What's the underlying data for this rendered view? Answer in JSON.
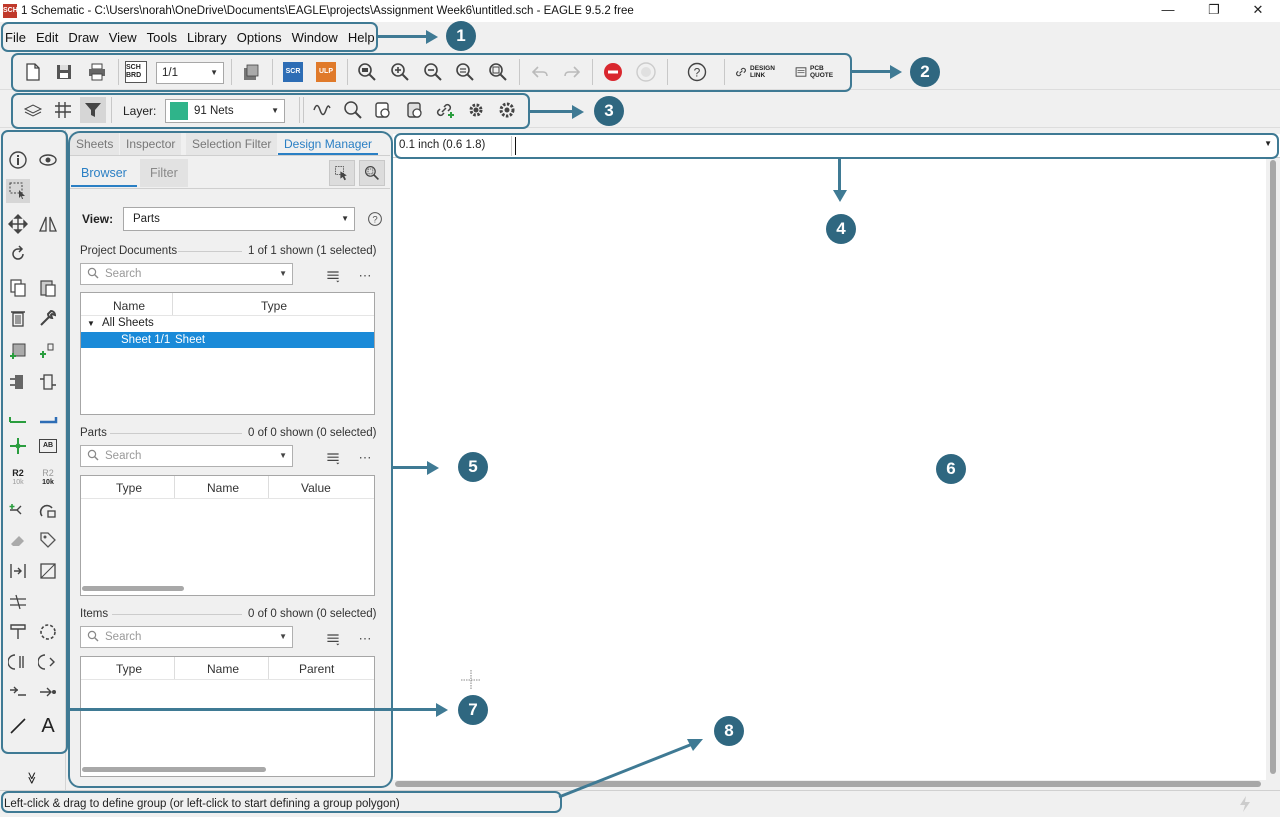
{
  "window": {
    "title": "1 Schematic - C:\\Users\\norah\\OneDrive\\Documents\\EAGLE\\projects\\Assignment Week6\\untitled.sch - EAGLE 9.5.2 free",
    "app_icon_text": "SCH",
    "minimize": "—",
    "restore": "❐",
    "close": "✕"
  },
  "menu": [
    "File",
    "Edit",
    "Draw",
    "View",
    "Tools",
    "Library",
    "Options",
    "Window",
    "Help"
  ],
  "toolbar1": {
    "sheet_select": "1/1",
    "sch_brd_label": "SCH BRD",
    "scr_label": "SCR",
    "ulp_label": "ULP",
    "design_link_label": "DESIGN LINK",
    "pcb_quote_label": "PCB QUOTE"
  },
  "toolbar2": {
    "layer_label": "Layer:",
    "layer_value": "91 Nets",
    "layer_color": "#2fb48a"
  },
  "panel": {
    "tabs": [
      "Sheets",
      "Inspector",
      "Selection Filter",
      "Design Manager"
    ],
    "subtabs": [
      "Browser",
      "Filter"
    ],
    "view_label": "View:",
    "view_value": "Parts",
    "sections": {
      "project_documents": {
        "title": "Project Documents",
        "count": "1 of 1 shown (1 selected)",
        "search_placeholder": "Search",
        "columns": [
          "Name",
          "Type"
        ],
        "tree_root": "All Sheets",
        "rows": [
          {
            "name": "Sheet 1/1",
            "type": "Sheet"
          }
        ]
      },
      "parts": {
        "title": "Parts",
        "count": "0 of 0 shown (0 selected)",
        "search_placeholder": "Search",
        "columns": [
          "Type",
          "Name",
          "Value"
        ]
      },
      "items": {
        "title": "Items",
        "count": "0 of 0 shown (0 selected)",
        "search_placeholder": "Search",
        "columns": [
          "Type",
          "Name",
          "Parent"
        ]
      }
    }
  },
  "command_line": {
    "grid_readout": "0.1 inch (0.6 1.8)",
    "value": ""
  },
  "left_tools": {
    "r2_label": "R2",
    "r2_sub": "10k",
    "ab_label": "AB",
    "text_tool_label": "A",
    "collapse_label": "≫"
  },
  "status": {
    "message": "Left-click & drag to define group (or left-click to start defining a group polygon)"
  },
  "annotations": {
    "callouts": [
      "1",
      "2",
      "3",
      "4",
      "5",
      "6",
      "7",
      "8"
    ],
    "color": "#2f6780"
  }
}
